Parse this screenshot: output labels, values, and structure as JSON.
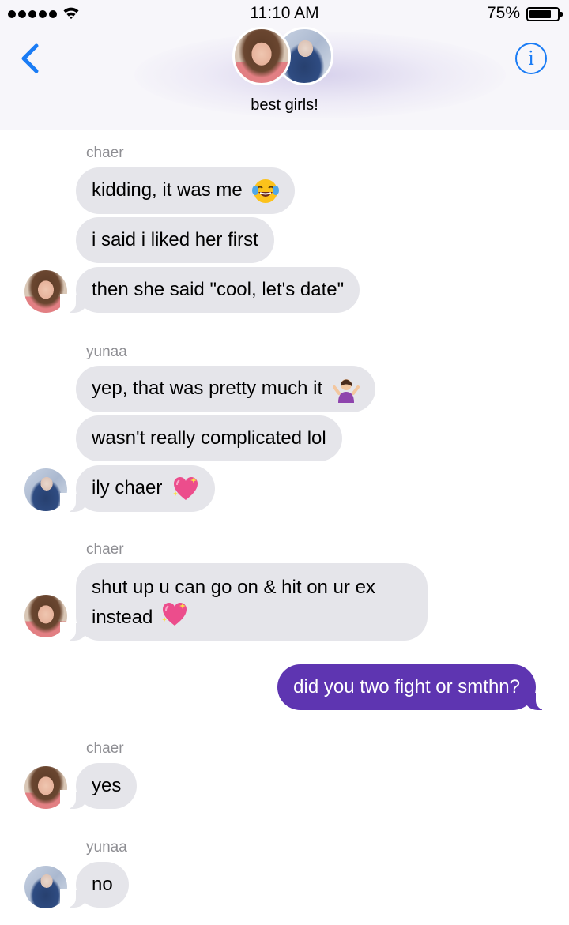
{
  "status_bar": {
    "time": "11:10 AM",
    "battery_percent": "75%",
    "battery_level": 0.75,
    "signal_bars": 5
  },
  "header": {
    "back_icon": "chevron-left-icon",
    "info_icon": "info-icon",
    "info_glyph": "i",
    "group_name": "best girls!",
    "accent_color": "#1a7cf5"
  },
  "messages": [
    {
      "sender": "chaer",
      "bubbles": [
        "kidding, it was me",
        "i said i liked her first",
        "then she said \"cool, let's date\""
      ],
      "emoji_after_first": "face-with-tears-of-joy"
    },
    {
      "sender": "yunaa",
      "bubbles": [
        "yep, that was pretty much it",
        "wasn't really complicated lol",
        "ily chaer"
      ],
      "emoji_after_first": "person-shrugging",
      "emoji_after_last": "sparkling-heart"
    },
    {
      "sender": "chaer",
      "bubbles": [
        "shut up u can go on & hit on ur ex instead"
      ],
      "emoji_after_last": "sparkling-heart"
    },
    {
      "outgoing": "did you two fight or smthn?"
    },
    {
      "sender": "chaer",
      "bubbles": [
        "yes"
      ]
    },
    {
      "sender": "yunaa",
      "bubbles": [
        "no"
      ]
    }
  ],
  "colors": {
    "incoming_bubble": "#e5e5ea",
    "outgoing_bubble": "#5e35b1",
    "sender_label": "#8e8e93"
  }
}
